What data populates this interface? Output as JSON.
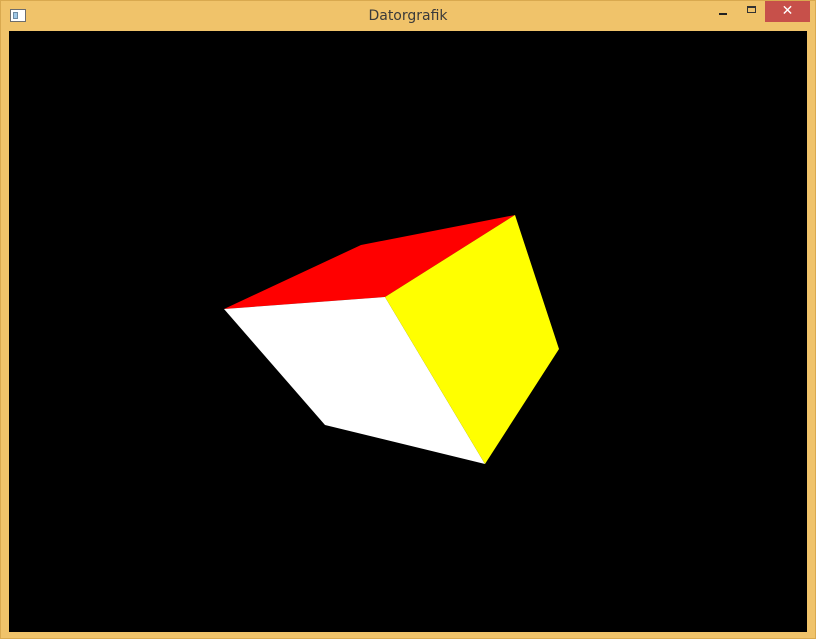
{
  "window": {
    "title": "Datorgrafik",
    "frame_color": "#f0c36a",
    "close_button_color": "#c7504a",
    "icons": {
      "app": "window-app-icon",
      "minimize": "minimize-icon",
      "maximize": "maximize-icon",
      "close": "close-icon"
    },
    "close_glyph": "✕"
  },
  "scene": {
    "background_color": "#000000",
    "object": "cube",
    "faces": [
      {
        "name": "top-face",
        "color": "#ff0000"
      },
      {
        "name": "front-face",
        "color": "#ffffff"
      },
      {
        "name": "right-face",
        "color": "#ffff00"
      }
    ]
  }
}
